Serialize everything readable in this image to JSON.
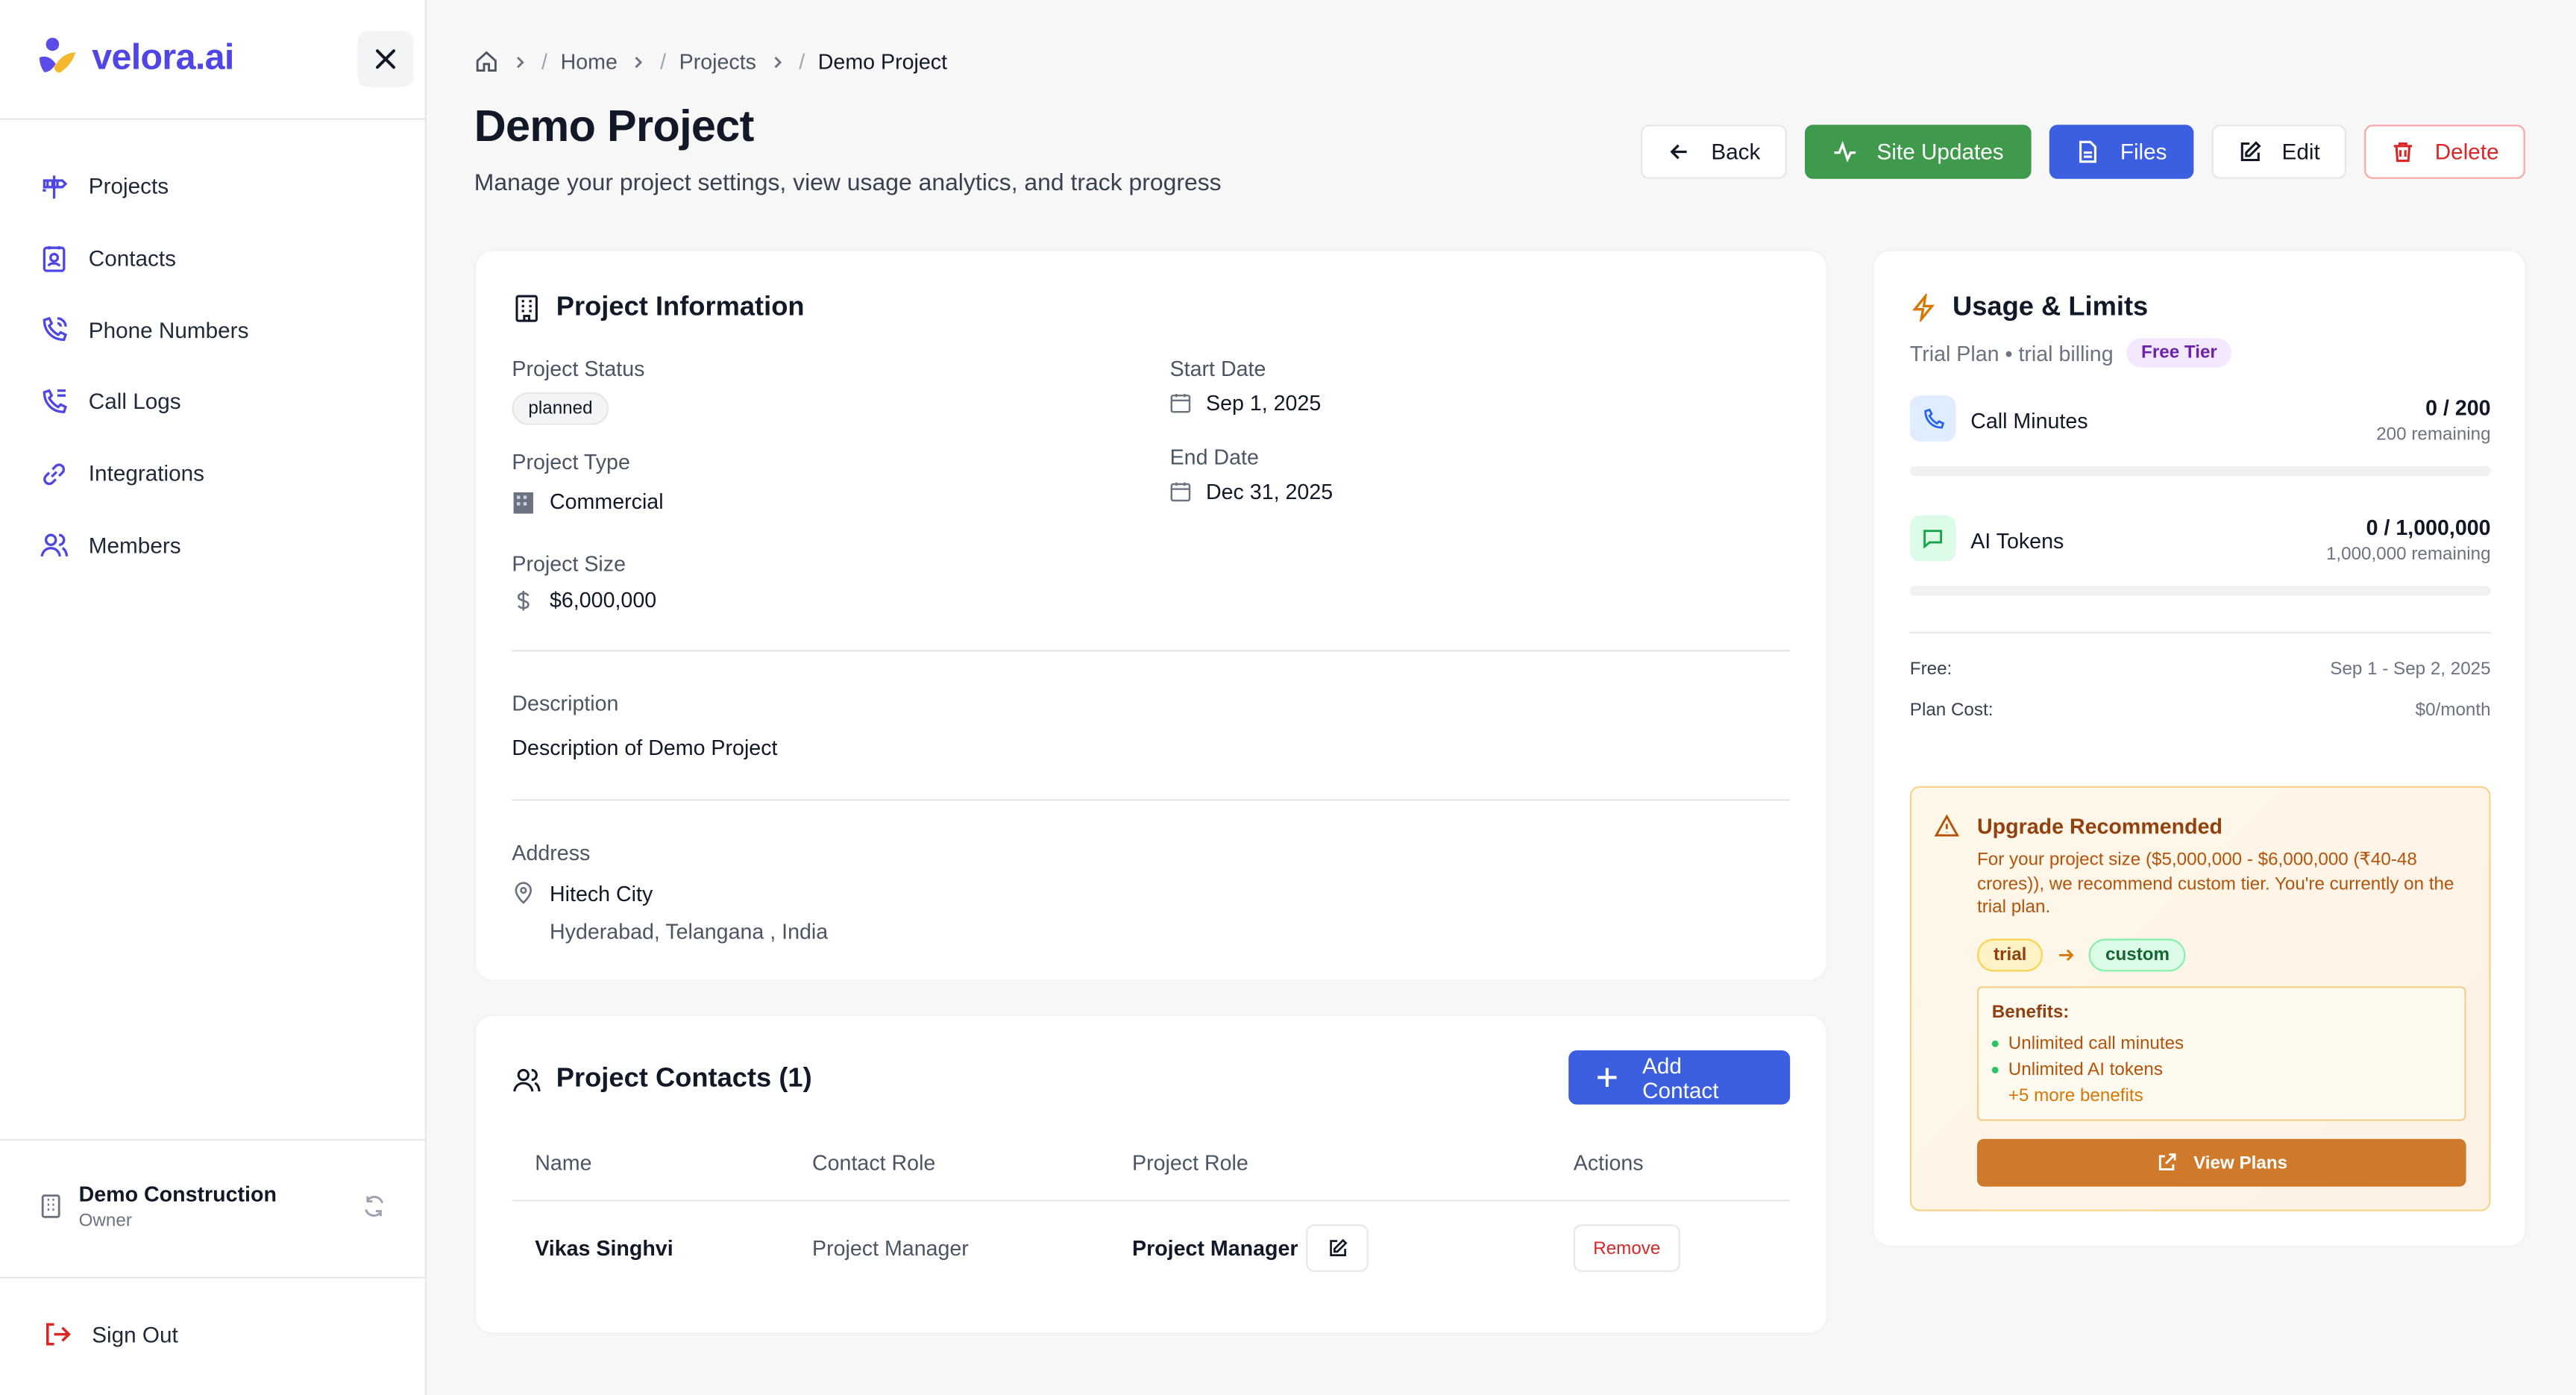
{
  "brand": {
    "name": "velora.ai"
  },
  "sidebar": {
    "items": [
      {
        "label": "Projects",
        "icon": "signpost-icon"
      },
      {
        "label": "Contacts",
        "icon": "contact-card-icon"
      },
      {
        "label": "Phone Numbers",
        "icon": "phone-icon"
      },
      {
        "label": "Call Logs",
        "icon": "phone-log-icon"
      },
      {
        "label": "Integrations",
        "icon": "link-icon"
      },
      {
        "label": "Members",
        "icon": "users-icon"
      }
    ],
    "org": {
      "name": "Demo Construction",
      "role": "Owner"
    },
    "sign_out": "Sign Out"
  },
  "breadcrumb": {
    "home": "Home",
    "projects": "Projects",
    "current": "Demo Project",
    "slash": "/"
  },
  "header": {
    "title": "Demo Project",
    "subtitle": "Manage your project settings, view usage analytics, and track progress",
    "back": "Back",
    "site_updates": "Site Updates",
    "files": "Files",
    "edit": "Edit",
    "delete": "Delete"
  },
  "project_info": {
    "title": "Project Information",
    "status_label": "Project Status",
    "status": "planned",
    "type_label": "Project Type",
    "type": "Commercial",
    "size_label": "Project Size",
    "size": "$6,000,000",
    "start_label": "Start Date",
    "start": "Sep 1, 2025",
    "end_label": "End Date",
    "end": "Dec 31, 2025",
    "description_label": "Description",
    "description": "Description of Demo Project",
    "address_label": "Address",
    "address_line1": "Hitech City",
    "address_line2": "Hyderabad, Telangana , India"
  },
  "contacts": {
    "title": "Project Contacts (1)",
    "add": "Add Contact",
    "columns": [
      "Name",
      "Contact Role",
      "Project Role",
      "Actions"
    ],
    "rows": [
      {
        "name": "Vikas Singhvi",
        "contact_role": "Project Manager",
        "project_role": "Project Manager",
        "action": "Remove"
      }
    ]
  },
  "usage": {
    "title": "Usage & Limits",
    "plan": "Trial Plan • trial billing",
    "tier": "Free Tier",
    "call_minutes": {
      "label": "Call Minutes",
      "value": "0 / 200",
      "remaining": "200 remaining",
      "fraction": 0
    },
    "ai_tokens": {
      "label": "AI Tokens",
      "value": "0 / 1,000,000",
      "remaining": "1,000,000 remaining",
      "fraction": 0
    },
    "free_label": "Free:",
    "free_value": "Sep 1 - Sep 2, 2025",
    "cost_label": "Plan Cost:",
    "cost_value": "$0/month"
  },
  "upgrade": {
    "title": "Upgrade Recommended",
    "text": "For your project size ($5,000,000 - $6,000,000 (₹40-48 crores)), we recommend custom tier. You're currently on the trial plan.",
    "from": "trial",
    "to": "custom",
    "benefits_label": "Benefits:",
    "benefits": [
      "Unlimited call minutes",
      "Unlimited AI tokens"
    ],
    "more": "+5 more benefits",
    "view_plans": "View Plans"
  },
  "colors": {
    "brand": "#4f46e5",
    "green": "#3f9a4b",
    "blue": "#3b5fe0",
    "red": "#dc2626",
    "orange": "#cf7a2b"
  }
}
